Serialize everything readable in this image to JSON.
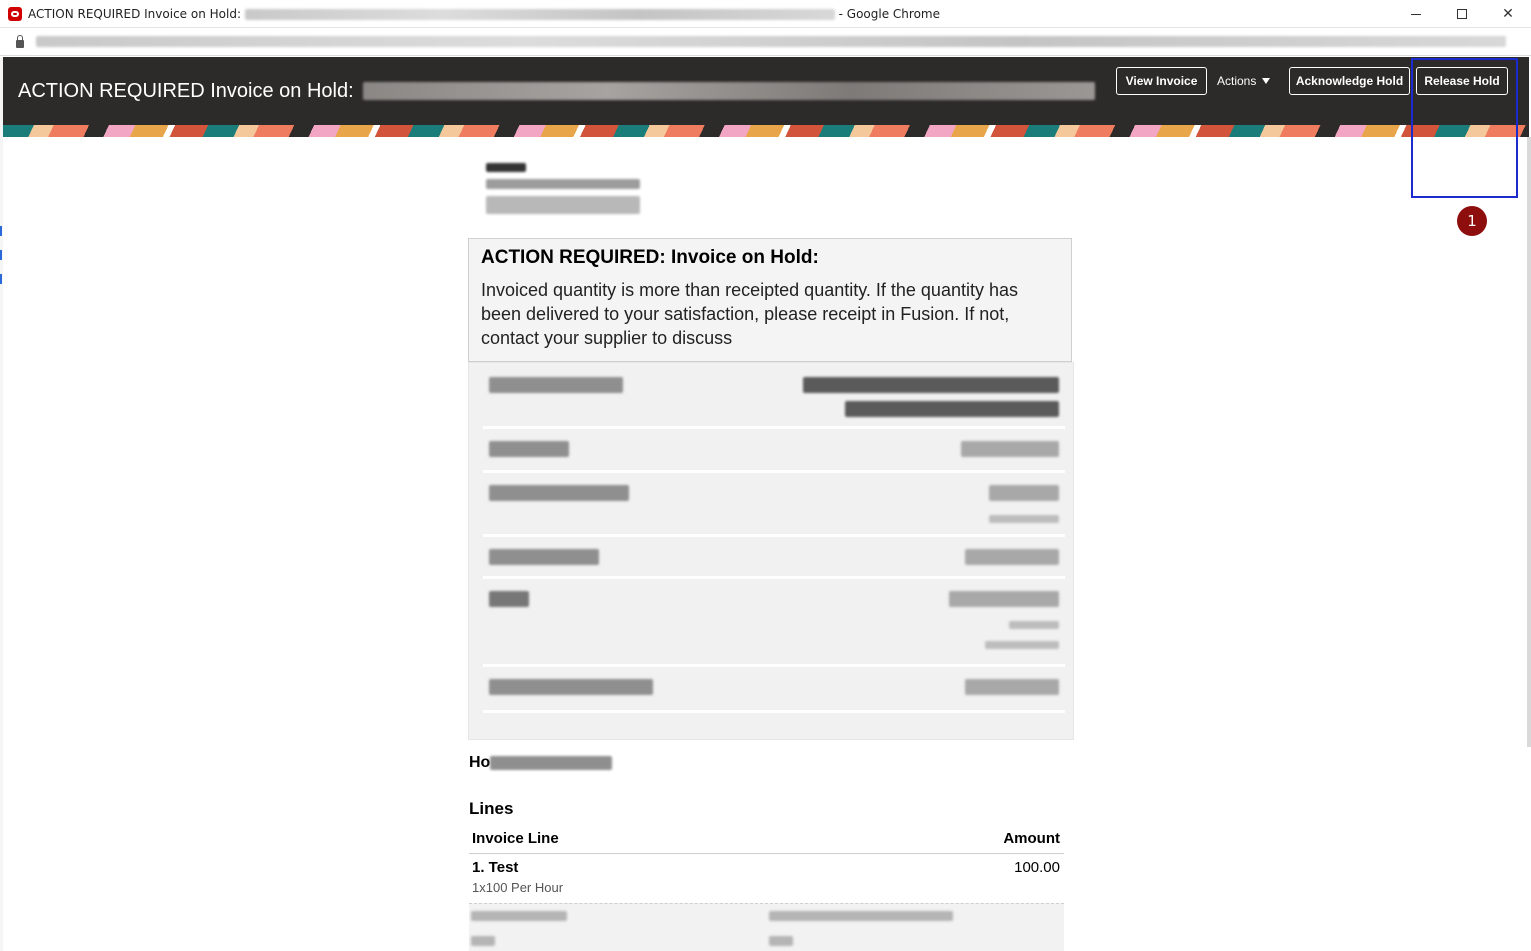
{
  "browser": {
    "window_title_prefix": "ACTION REQUIRED Invoice on Hold:",
    "window_title_suffix": "- Google Chrome"
  },
  "header": {
    "title": "ACTION REQUIRED Invoice on Hold:",
    "buttons": {
      "view_invoice": "View Invoice",
      "actions": "Actions",
      "acknowledge_hold": "Acknowledge Hold",
      "release_hold": "Release Hold"
    }
  },
  "annotation": {
    "badge": "1",
    "color": "#1c2bcf",
    "badge_color": "#8e0d0d"
  },
  "notice": {
    "title": "ACTION REQUIRED: Invoice on Hold:",
    "body": "Invoiced quantity is more than receipted quantity. If the quantity has been delivered to your satisfaction, please receipt in Fusion. If not, contact your supplier to discuss"
  },
  "hold_section": {
    "label_visible": "Ho"
  },
  "lines": {
    "title": "Lines",
    "columns": {
      "line": "Invoice Line",
      "amount": "Amount"
    },
    "rows": [
      {
        "name": "1. Test",
        "detail": "1x100 Per Hour",
        "amount": "100.00"
      }
    ]
  },
  "colors": {
    "header_bg": "#2d2b29",
    "card_bg": "#f4f4f4",
    "details_bg": "#f1f1f1"
  }
}
